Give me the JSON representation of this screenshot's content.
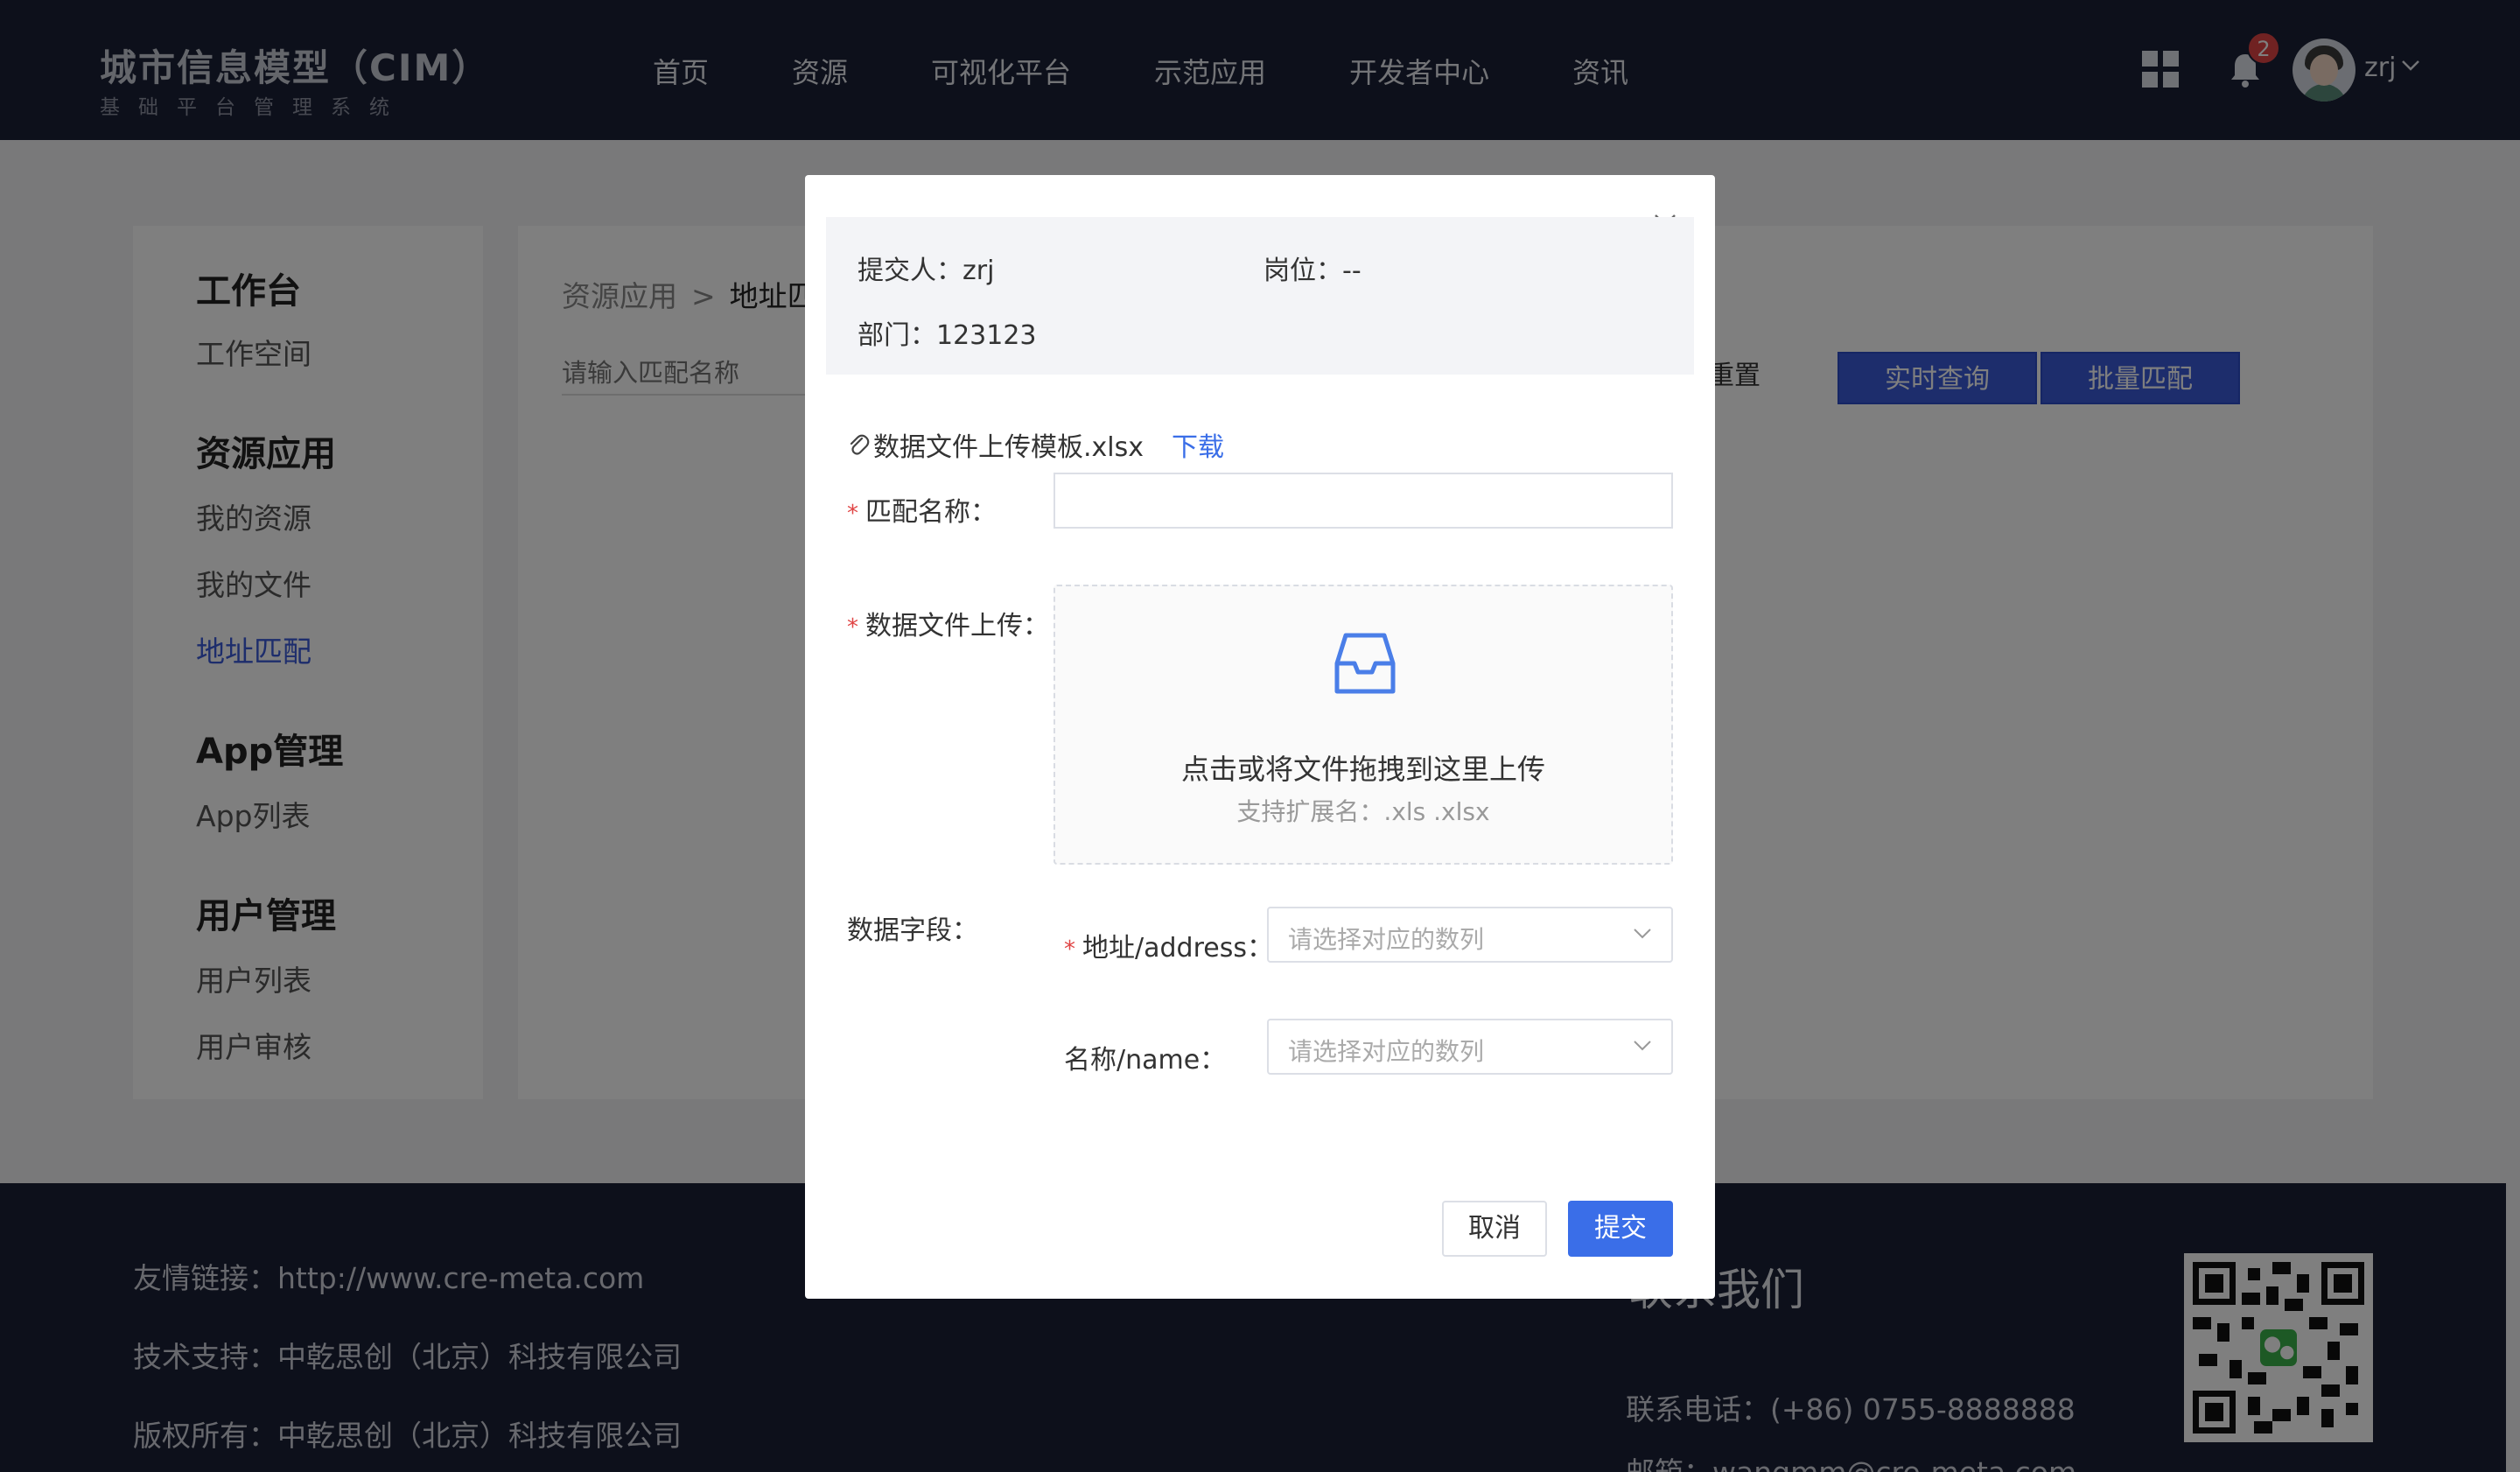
{
  "header": {
    "logo_title": "城市信息模型（CIM）",
    "logo_subtitle": "基础平台管理系统",
    "nav": [
      "首页",
      "资源",
      "可视化平台",
      "示范应用",
      "开发者中心",
      "资讯"
    ],
    "notification_count": "2",
    "user_name": "zrj"
  },
  "sidebar": {
    "groups": [
      {
        "title": "工作台",
        "items": [
          "工作空间"
        ]
      },
      {
        "title": "资源应用",
        "items": [
          "我的资源",
          "我的文件",
          "地址匹配"
        ]
      },
      {
        "title": "App管理",
        "items": [
          "App列表"
        ]
      },
      {
        "title": "用户管理",
        "items": [
          "用户列表",
          "用户审核"
        ]
      }
    ],
    "active_item": "地址匹配"
  },
  "content": {
    "breadcrumb": [
      "资源应用",
      ">",
      "地址匹配"
    ],
    "search_placeholder": "请输入匹配名称",
    "reset_label": "重置",
    "query_label": "实时查询",
    "batch_label": "批量匹配"
  },
  "footer": {
    "links": [
      "友情链接：http://www.cre-meta.com",
      "技术支持：中乾思创（北京）科技有限公司",
      "版权所有：中乾思创（北京）科技有限公司"
    ],
    "contact_title": "联系我们",
    "phone": "联系电话：(+86) 0755-8888888",
    "email": "邮箱：wangmm@cre-meta.com"
  },
  "modal": {
    "submitter_label": "提交人：zrj",
    "position_label": "岗位：--",
    "department_label": "部门：123123",
    "template_file": "数据文件上传模板.xlsx",
    "download_label": "下载",
    "match_name_label": "匹配名称：",
    "match_name_value": "",
    "upload_label": "数据文件上传：",
    "upload_main": "点击或将文件拖拽到这里上传",
    "upload_hint": "支持扩展名：.xls .xlsx",
    "fields_label": "数据字段：",
    "address_label": "地址/address：",
    "name_label": "名称/name：",
    "select_placeholder": "请选择对应的数列",
    "cancel_label": "取消",
    "submit_label": "提交"
  },
  "colors": {
    "header_bg": "#1b2136",
    "primary": "#3a6ee8",
    "required": "#e04545"
  }
}
